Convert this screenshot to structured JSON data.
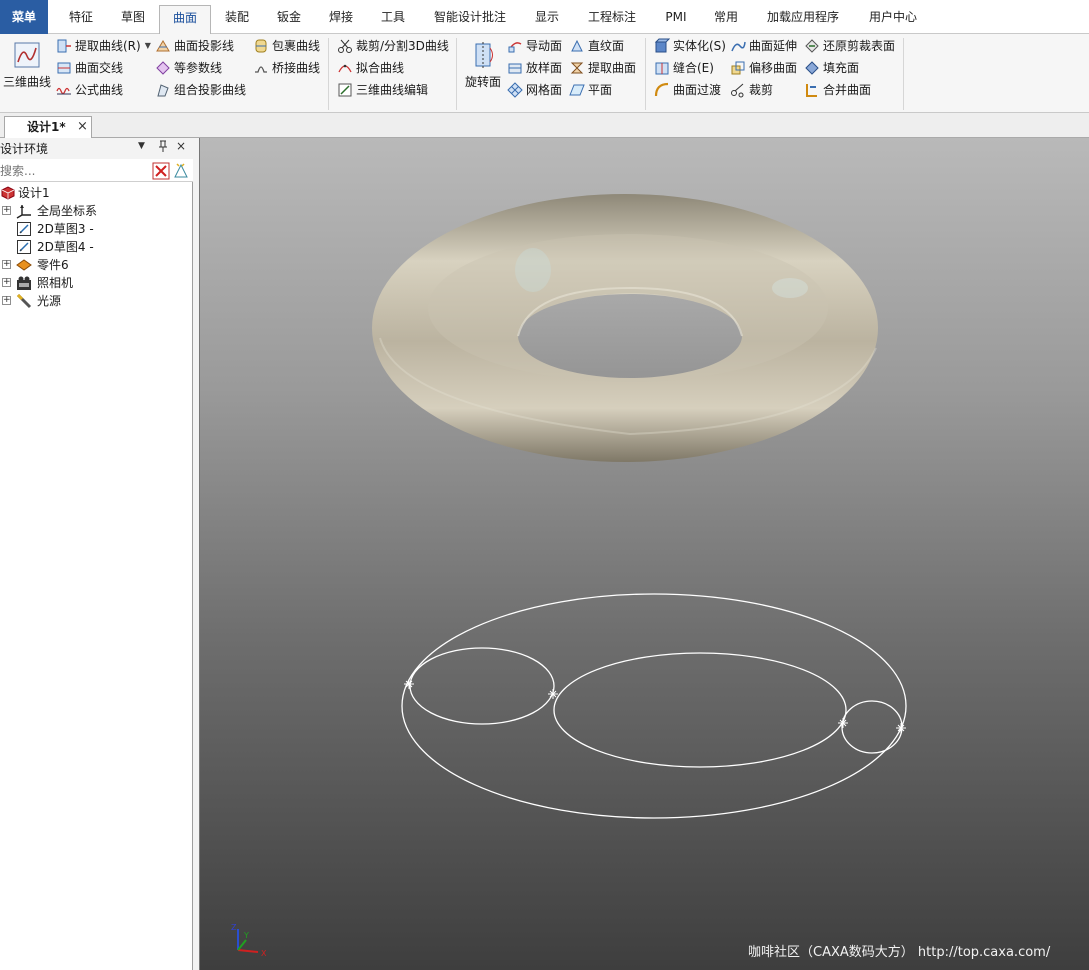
{
  "tabs": [
    {
      "label": "菜单"
    },
    {
      "label": "特征"
    },
    {
      "label": "草图"
    },
    {
      "label": "曲面"
    },
    {
      "label": "装配"
    },
    {
      "label": "钣金"
    },
    {
      "label": "焊接"
    },
    {
      "label": "工具"
    },
    {
      "label": "智能设计批注"
    },
    {
      "label": "显示"
    },
    {
      "label": "工程标注"
    },
    {
      "label": "PMI"
    },
    {
      "label": "常用"
    },
    {
      "label": "加载应用程序"
    },
    {
      "label": "用户中心"
    }
  ],
  "active_tab": "曲面",
  "ribbon": {
    "three_d_curve": "三维曲线",
    "extract_curve": "提取曲线(R)",
    "surface_intersect": "曲面交线",
    "formula_curve": "公式曲线",
    "surface_project": "曲面投影线",
    "iso_param": "等参数线",
    "combo_project": "组合投影曲线",
    "wrap_curve": "包裹曲线",
    "bridge_curve": "桥接曲线",
    "trim_split_3d": "裁剪/分割3D曲线",
    "fit_curve": "拟合曲线",
    "edit_3d_curve": "三维曲线编辑",
    "revolve_surface": "旋转面",
    "guide_surface": "导动面",
    "loft_surface": "放样面",
    "mesh_surface": "网格面",
    "ruled_surface": "直纹面",
    "extract_surface": "提取曲面",
    "plane": "平面",
    "solidify": "实体化(S)",
    "sew": "缝合(E)",
    "surface_blend": "曲面过渡",
    "surface_extend": "曲面延伸",
    "offset_surface": "偏移曲面",
    "trim": "裁剪",
    "restore_trim": "还原剪裁表面",
    "fill_surface": "填充面",
    "merge_surface": "合并曲面"
  },
  "doc_tab": {
    "label": "设计1*",
    "close": "×"
  },
  "panel": {
    "title": "设计环境",
    "pin": "ㅁ",
    "close": "×",
    "search_placeholder": "搜索..."
  },
  "tree": [
    {
      "label": "设计1",
      "icon": "design-icon",
      "expandable": false,
      "indent": 0
    },
    {
      "label": "全局坐标系",
      "icon": "axes-icon",
      "expandable": true,
      "indent": 1
    },
    {
      "label": "2D草图3 -",
      "icon": "sketch-icon",
      "expandable": false,
      "indent": 1
    },
    {
      "label": "2D草图4 -",
      "icon": "sketch-icon",
      "expandable": false,
      "indent": 1
    },
    {
      "label": "零件6",
      "icon": "part-icon",
      "expandable": true,
      "indent": 1
    },
    {
      "label": "照相机",
      "icon": "camera-icon",
      "expandable": true,
      "indent": 1
    },
    {
      "label": "光源",
      "icon": "light-icon",
      "expandable": true,
      "indent": 1
    }
  ],
  "viewport": {
    "watermark": "咖啡社区（CAXA数码大方） http://top.caxa.com/",
    "triad": {
      "x": "X",
      "y": "Y",
      "z": "Z"
    }
  },
  "colors": {
    "accent": "#2a5da3",
    "torus": "#b5ae9e",
    "wire": "#ffffff"
  }
}
